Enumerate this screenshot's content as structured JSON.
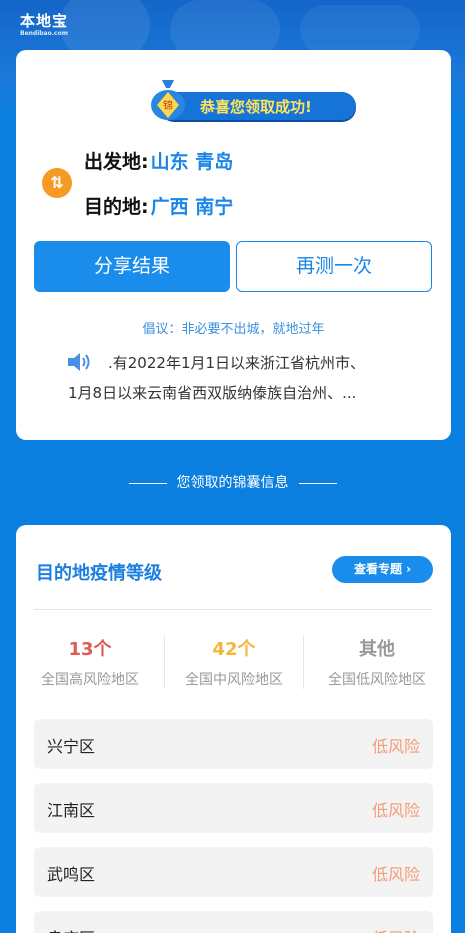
{
  "header": {
    "logo_main": "本地宝",
    "logo_sub": "Bendibao.com"
  },
  "result": {
    "banner_text": "恭喜您领取成功!",
    "bag_glyph": "锦",
    "from_label": "出发地:",
    "from_value": "山东 青岛",
    "to_label": "目的地:",
    "to_value": "广西 南宁",
    "share_label": "分享结果",
    "retry_label": "再测一次",
    "advice": "倡议：非必要不出城，就地过年",
    "notice_line1": ".有2022年1月1日以来浙江省杭州市、",
    "notice_line2": "1月8日以来云南省西双版纳傣族自治州、..."
  },
  "section": {
    "title": "您领取的锦囊信息"
  },
  "level": {
    "title": "目的地疫情等级",
    "topic_button": "查看专题 ›",
    "stats": [
      {
        "num": "13个",
        "caption": "全国高风险地区",
        "color": "#e05a52"
      },
      {
        "num": "42个",
        "caption": "全国中风险地区",
        "color": "#f6b43b"
      },
      {
        "num": "其他",
        "caption": "全国低风险地区",
        "color": "#999999"
      }
    ],
    "areas": [
      {
        "name": "兴宁区",
        "risk": "低风险"
      },
      {
        "name": "江南区",
        "risk": "低风险"
      },
      {
        "name": "武鸣区",
        "risk": "低风险"
      },
      {
        "name": "良庆区",
        "risk": "低风险"
      }
    ],
    "risk_color": "#f59a7a"
  },
  "icons": {
    "swap": "swap-vertical-icon",
    "speaker": "speaker-icon",
    "bag": "lucky-bag-icon"
  }
}
